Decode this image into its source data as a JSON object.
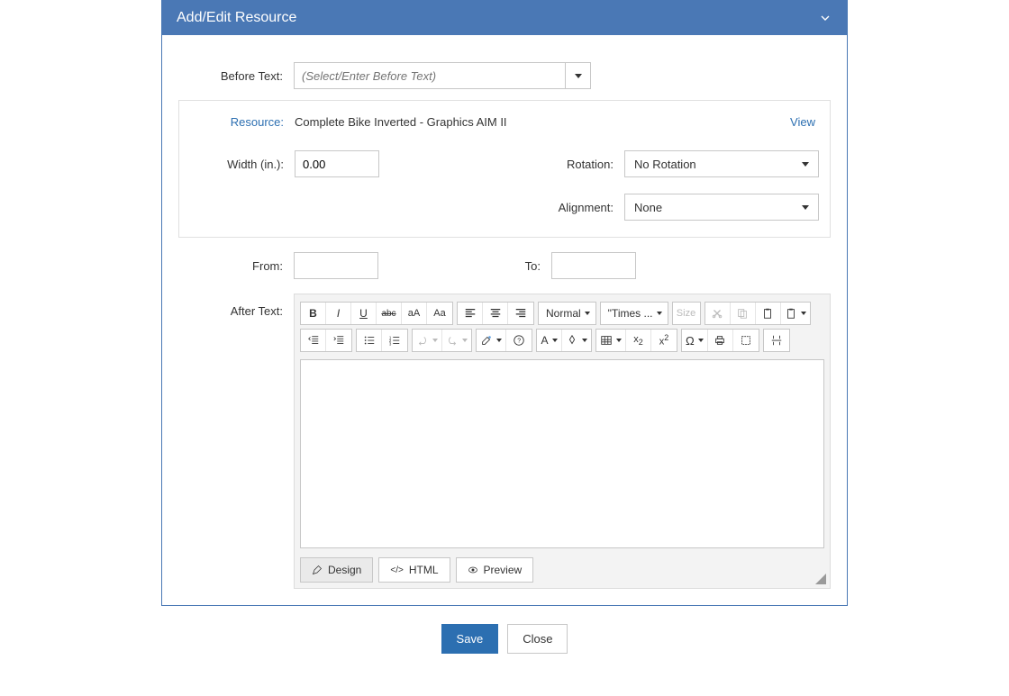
{
  "header": {
    "title": "Add/Edit Resource"
  },
  "fields": {
    "before_text_label": "Before Text:",
    "before_text_placeholder": "(Select/Enter Before Text)",
    "resource_label": "Resource:",
    "resource_name": "Complete Bike Inverted - Graphics AIM II",
    "view_link": "View",
    "width_label": "Width (in.):",
    "width_value": "0.00",
    "rotation_label": "Rotation:",
    "rotation_value": "No Rotation",
    "alignment_label": "Alignment:",
    "alignment_value": "None",
    "from_label": "From:",
    "from_value": "",
    "to_label": "To:",
    "to_value": "",
    "after_text_label": "After Text:"
  },
  "editor": {
    "format_label": "Normal",
    "font_label": "\"Times ...",
    "size_label": "Size",
    "tabs": {
      "design": "Design",
      "html": "HTML",
      "preview": "Preview"
    }
  },
  "footer": {
    "save": "Save",
    "close": "Close"
  }
}
